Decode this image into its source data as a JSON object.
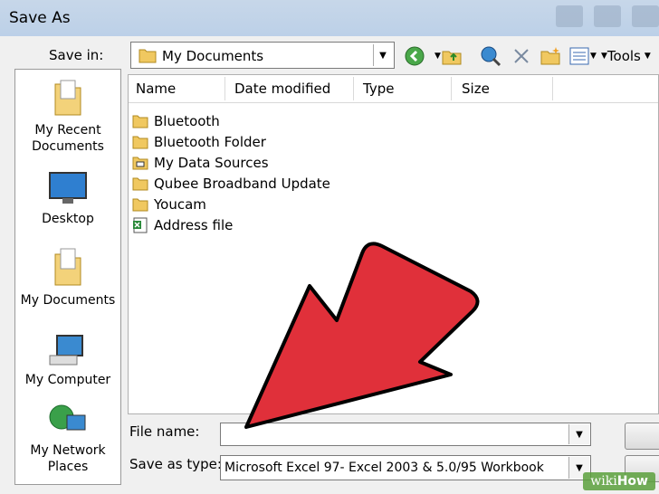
{
  "window": {
    "title": "Save As"
  },
  "toolbar": {
    "save_in_label": "Save in:",
    "save_in_value": "My Documents",
    "tools_label": "Tools"
  },
  "places": [
    {
      "label": "My Recent Documents",
      "icon": "recent-documents-icon"
    },
    {
      "label": "Desktop",
      "icon": "desktop-icon"
    },
    {
      "label": "My Documents",
      "icon": "my-documents-icon"
    },
    {
      "label": "My Computer",
      "icon": "my-computer-icon"
    },
    {
      "label": "My Network Places",
      "icon": "network-places-icon"
    }
  ],
  "columns": [
    "Name",
    "Date modified",
    "Type",
    "Size"
  ],
  "files": [
    {
      "name": "Bluetooth",
      "icon": "folder-icon"
    },
    {
      "name": "Bluetooth Folder",
      "icon": "folder-icon"
    },
    {
      "name": "My Data Sources",
      "icon": "data-sources-folder-icon"
    },
    {
      "name": "Qubee Broadband Update",
      "icon": "folder-icon"
    },
    {
      "name": "Youcam",
      "icon": "folder-icon"
    },
    {
      "name": "Address file",
      "icon": "excel-file-icon"
    }
  ],
  "form": {
    "file_name_label": "File name:",
    "file_name_value": "",
    "save_as_type_label": "Save as type:",
    "save_as_type_value": "Microsoft Excel 97- Excel 2003 & 5.0/95 Workbook"
  },
  "colors": {
    "arrow": "#e0303a",
    "title_bar": "#c7d7e9"
  },
  "watermark": {
    "prefix": "wiki",
    "suffix": "How"
  }
}
